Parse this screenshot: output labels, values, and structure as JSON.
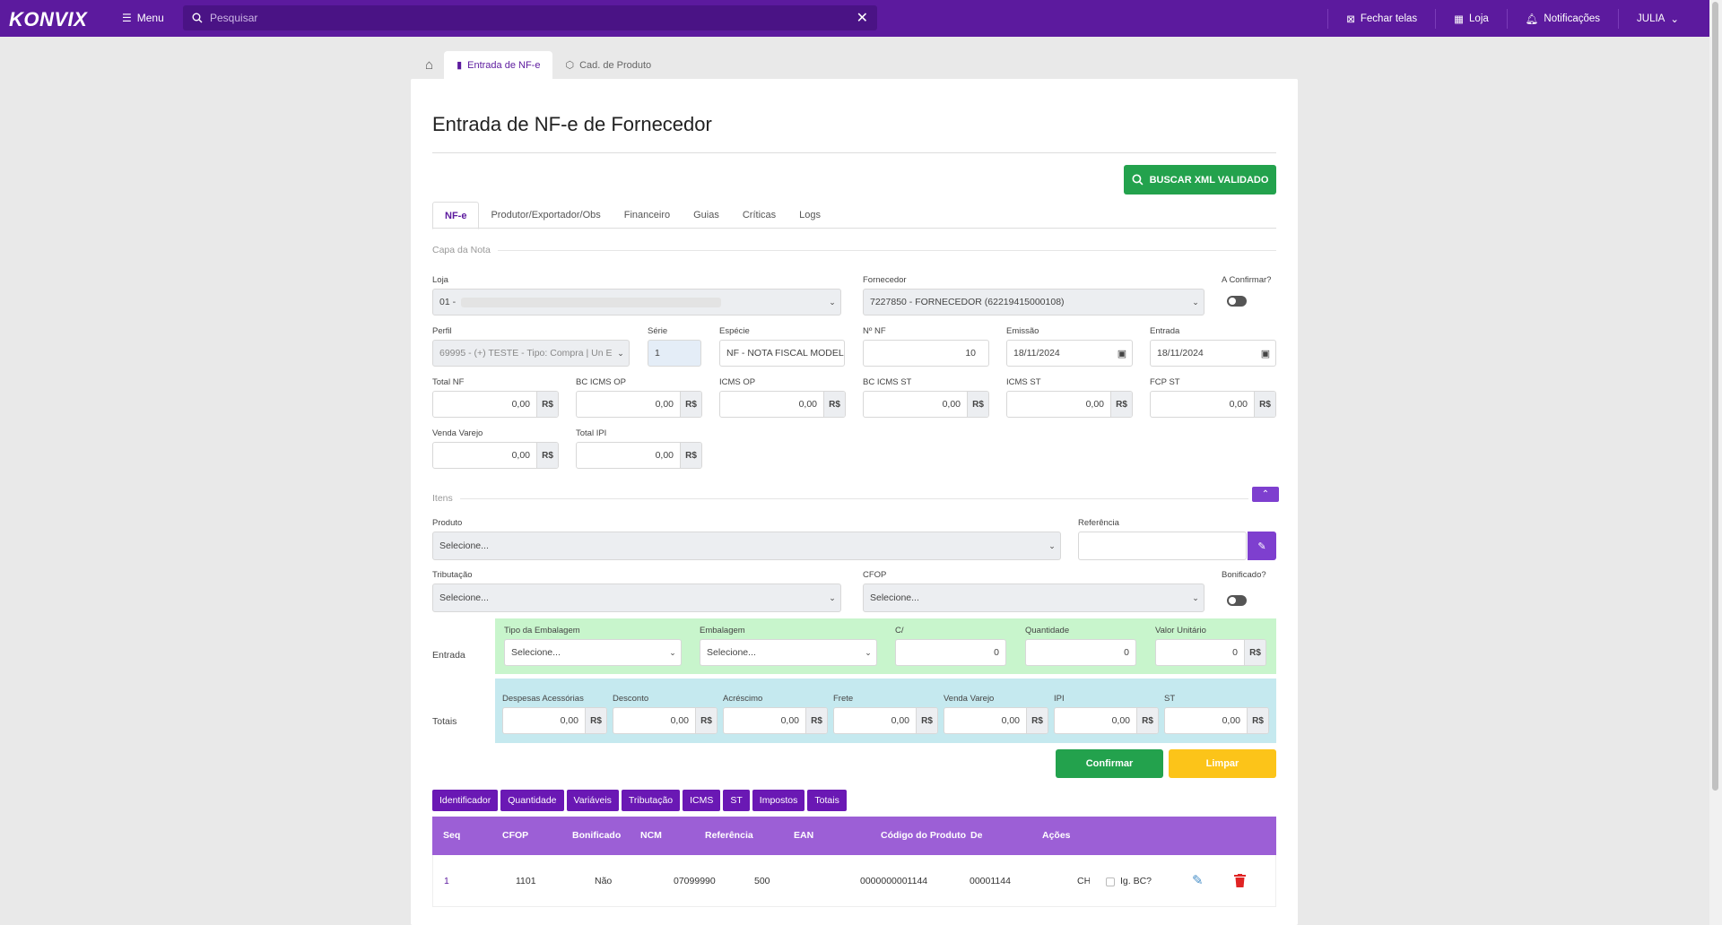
{
  "topbar": {
    "logo": "KONVIX",
    "menu_label": "Menu",
    "search_placeholder": "Pesquisar",
    "fechar_telas": "Fechar telas",
    "loja": "Loja",
    "notificacoes": "Notificações",
    "user": "JULIA"
  },
  "page_tabs": [
    "Entrada de NF-e",
    "Cad. de Produto"
  ],
  "title": "Entrada de NF-e de Fornecedor",
  "buscar_xml": "BUSCAR XML VALIDADO",
  "tabs": [
    "NF-e",
    "Produtor/Exportador/Obs",
    "Financeiro",
    "Guias",
    "Críticas",
    "Logs"
  ],
  "capa": {
    "section": "Capa da Nota",
    "loja_label": "Loja",
    "loja_value": "01 -",
    "fornecedor_label": "Fornecedor",
    "fornecedor_value": "7227850 - FORNECEDOR (62219415000108)",
    "aconfirmar_label": "A Confirmar?",
    "perfil_label": "Perfil",
    "perfil_value": "69995 - (+) TESTE - Tipo: Compra | Un E...",
    "serie_label": "Série",
    "serie_value": "1",
    "especie_label": "Espécie",
    "especie_value": "NF - NOTA FISCAL MODEL",
    "nnf_label": "Nº NF",
    "nnf_value": "10",
    "emissao_label": "Emissão",
    "emissao_value": "18/11/2024",
    "entrada_label": "Entrada",
    "entrada_value": "18/11/2024",
    "currency": "R$",
    "totais": [
      {
        "label": "Total NF",
        "value": "0,00"
      },
      {
        "label": "BC ICMS OP",
        "value": "0,00"
      },
      {
        "label": "ICMS OP",
        "value": "0,00"
      },
      {
        "label": "BC ICMS ST",
        "value": "0,00"
      },
      {
        "label": "ICMS ST",
        "value": "0,00"
      },
      {
        "label": "FCP ST",
        "value": "0,00"
      },
      {
        "label": "Venda Varejo",
        "value": "0,00"
      },
      {
        "label": "Total IPI",
        "value": "0,00"
      }
    ]
  },
  "itens": {
    "section": "Itens",
    "produto_label": "Produto",
    "produto_value": "Selecione...",
    "referencia_label": "Referência",
    "tributacao_label": "Tributação",
    "tributacao_value": "Selecione...",
    "cfop_label": "CFOP",
    "cfop_value": "Selecione...",
    "bonificado_label": "Bonificado?",
    "entrada_row_label": "Entrada",
    "tipo_emb_label": "Tipo da Embalagem",
    "tipo_emb_value": "Selecione...",
    "emb_label": "Embalagem",
    "emb_value": "Selecione...",
    "c_label": "C/",
    "c_value": "0",
    "qtd_label": "Quantidade",
    "qtd_value": "0",
    "vu_label": "Valor Unitário",
    "vu_value": "0",
    "totais_row_label": "Totais",
    "totais": [
      {
        "label": "Despesas Acessórias",
        "value": "0,00"
      },
      {
        "label": "Desconto",
        "value": "0,00"
      },
      {
        "label": "Acréscimo",
        "value": "0,00"
      },
      {
        "label": "Frete",
        "value": "0,00"
      },
      {
        "label": "Venda Varejo",
        "value": "0,00"
      },
      {
        "label": "IPI",
        "value": "0,00"
      },
      {
        "label": "ST",
        "value": "0,00"
      }
    ],
    "confirmar": "Confirmar",
    "limpar": "Limpar"
  },
  "grid_tabs": [
    "Identificador",
    "Quantidade",
    "Variáveis",
    "Tributação",
    "ICMS",
    "ST",
    "Impostos",
    "Totais"
  ],
  "table": {
    "headers": [
      "Seq",
      "CFOP",
      "Bonificado",
      "NCM",
      "Referência",
      "EAN",
      "Código do Produto",
      "De",
      "Ações"
    ],
    "rows": [
      {
        "seq": "1",
        "cfop": "1101",
        "bonificado": "Não",
        "ncm": "07099990",
        "referencia": "500",
        "ean": "0000000001144",
        "codigo": "00001144",
        "de": "CH",
        "ig_bc": "Ig. BC?"
      }
    ]
  },
  "colors": {
    "primary": "#5c1a9e",
    "green": "#23a24d",
    "yellow": "#fcc419",
    "table_header": "#9c5fd6"
  }
}
